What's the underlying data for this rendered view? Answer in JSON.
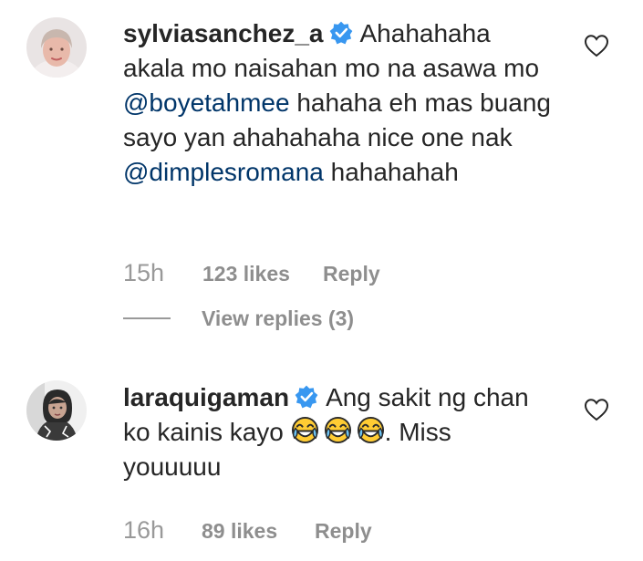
{
  "comments": [
    {
      "username": "sylviasanchez_a",
      "verified": true,
      "text_parts": [
        "Ahahahaha akala mo naisahan mo na asawa mo ",
        "@boyetahmee",
        " hahaha eh mas buang sayo yan ahahahaha nice one nak ",
        "@dimplesromana",
        " hahahahah"
      ],
      "time": "15h",
      "likes": "123 likes",
      "reply_label": "Reply",
      "view_replies": "View replies (3)"
    },
    {
      "username": "laraquigaman",
      "verified": true,
      "text_parts": [
        "Ang sakit ng chan ko kainis kayo ",
        ". Miss youuuuu"
      ],
      "emoji": [
        "face-with-tears-of-joy",
        "face-with-tears-of-joy",
        "face-with-tears-of-joy"
      ],
      "time": "16h",
      "likes": "89 likes",
      "reply_label": "Reply"
    }
  ],
  "colors": {
    "text": "#262626",
    "mention": "#003569",
    "meta": "#8e8e8e",
    "verified": "#3897f0"
  }
}
